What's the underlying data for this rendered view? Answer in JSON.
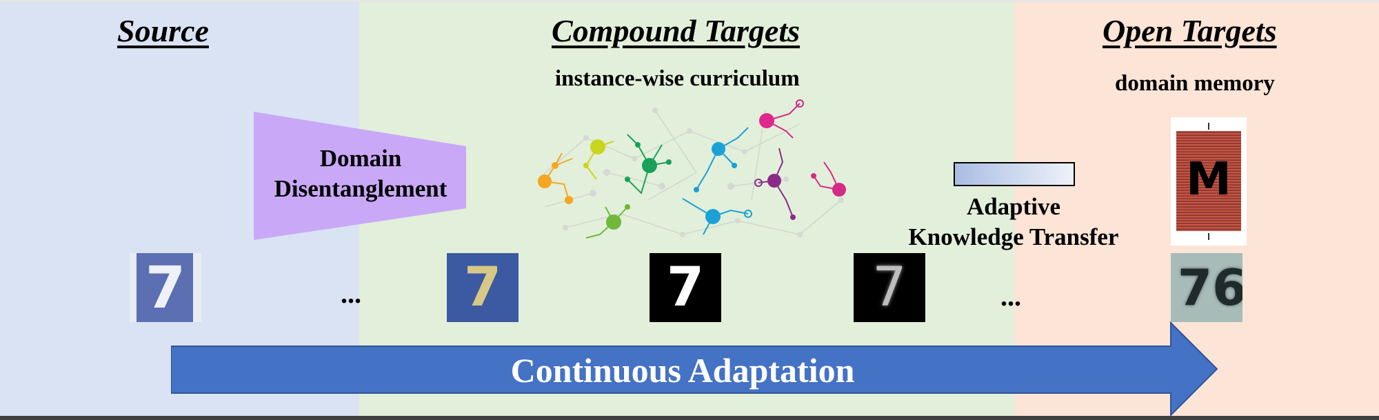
{
  "colors": {
    "source_bg": "#dae3f3",
    "compound_bg": "#e2efda",
    "open_bg": "#fce4d6",
    "arrow_fill": "#4472c4",
    "disentangle_fill": "#c9a8f8",
    "memory_stripes": "#b34a3a"
  },
  "panels": {
    "source": {
      "title": "Source"
    },
    "compound": {
      "title": "Compound Targets",
      "subtitle": "instance-wise curriculum"
    },
    "open": {
      "title": "Open Targets",
      "subtitle": "domain memory"
    }
  },
  "modules": {
    "disentangle": {
      "line1": "Domain",
      "line2": "Disentanglement"
    },
    "transfer": {
      "line1": "Adaptive",
      "line2": "Knowledge Transfer"
    },
    "memory": {
      "letter": "M"
    }
  },
  "samples": [
    {
      "glyph": "7",
      "style": "svhn-blue"
    },
    {
      "glyph": "7",
      "style": "synthetic-blue"
    },
    {
      "glyph": "7",
      "style": "mnist-white"
    },
    {
      "glyph": "7",
      "style": "mnist-soft"
    },
    {
      "glyph": "76",
      "style": "svhn-gray"
    }
  ],
  "ellipsis": "...",
  "arrow": {
    "label": "Continuous Adaptation"
  },
  "icons": {
    "curriculum_graph": "network-graph-icon",
    "transfer_bar": "gradient-bar-icon",
    "memory_block": "memory-block-icon"
  }
}
